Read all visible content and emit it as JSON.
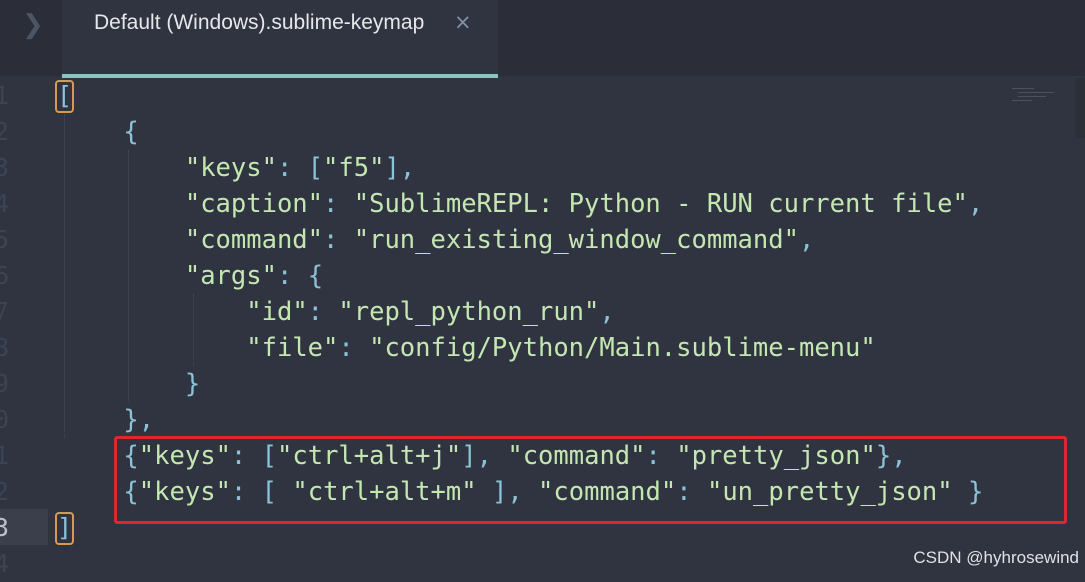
{
  "tab": {
    "title": "Default (Windows).sublime-keymap",
    "close_glyph": "×",
    "chevron_glyph": "❯"
  },
  "gutter": {
    "line_numbers": [
      "1",
      "2",
      "3",
      "4",
      "5",
      "6",
      "7",
      "8",
      "9",
      "0",
      "1",
      "2",
      "3",
      "4"
    ]
  },
  "code": {
    "lines": [
      "",
      "    {",
      "        \"keys\": [\"f5\"],",
      "        \"caption\": \"SublimeREPL: Python - RUN current file\",",
      "        \"command\": \"run_existing_window_command\",",
      "        \"args\": {",
      "            \"id\": \"repl_python_run\",",
      "            \"file\": \"config/Python/Main.sublime-menu\"",
      "        }",
      "    },",
      "    {\"keys\": [\"ctrl+alt+j\"], \"command\": \"pretty_json\"},",
      "    {\"keys\": [ \"ctrl+alt+m\" ], \"command\": \"un_pretty_json\" }",
      ""
    ],
    "open_bracket": "[",
    "close_bracket": "]"
  },
  "watermark": "CSDN @hyhrosewind",
  "colors": {
    "background": "#303440",
    "string": "#c4e7b2",
    "punctuation": "#8bc2d8",
    "bracket_match_border": "#d69a51",
    "annotation_box": "#e0252f",
    "tab_underline": "#8ac4bf"
  }
}
